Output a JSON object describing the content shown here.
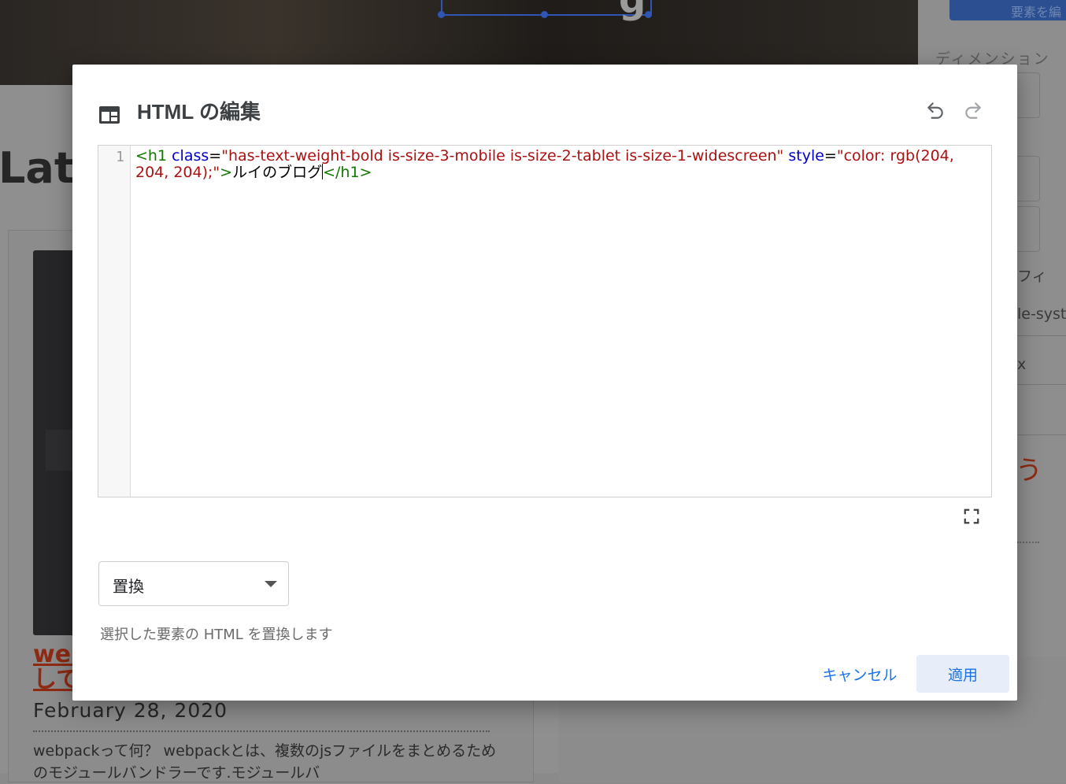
{
  "background": {
    "section_heading": "Late",
    "post_title": "wel\nして",
    "post_date": "February 28, 2020",
    "post_excerpt": "webpackって何？ webpackとは、複数のjsファイルをまとめるためのモジュールバンドラーです.モジュールバ",
    "panel_button_label": "要素を編",
    "panel_label_dimension": "ディメンション",
    "panel_text_typography": "フィ",
    "panel_text_font": "le-syst",
    "panel_text_unit": "x",
    "panel_orange_glyph": "う"
  },
  "dialog": {
    "icon": "web-layout-icon",
    "title": "HTML の編集",
    "undo_icon": "undo-icon",
    "redo_icon": "redo-icon",
    "editor": {
      "line_number": "1",
      "tokens": {
        "open_tag": "<h1",
        "attr_class": "class",
        "eq1": "=",
        "class_value": "\"has-text-weight-bold is-size-3-mobile is-size-2-tablet is-size-1-widescreen\"",
        "attr_style": "style",
        "eq2": "=",
        "style_value": "\"color: rgb(204, 204, 204);\"",
        "open_tag_end": ">",
        "text": "ルイのブログ",
        "close_tag": "</h1>"
      }
    },
    "fullscreen_icon": "fullscreen-icon",
    "mode_select": {
      "value": "置換",
      "help_text": "選択した要素の HTML を置換します"
    },
    "cancel_label": "キャンセル",
    "apply_label": "適用"
  },
  "colors": {
    "accent": "#1a73e8",
    "tag": "#117700",
    "attribute": "#0000cc",
    "string": "#aa1111"
  }
}
